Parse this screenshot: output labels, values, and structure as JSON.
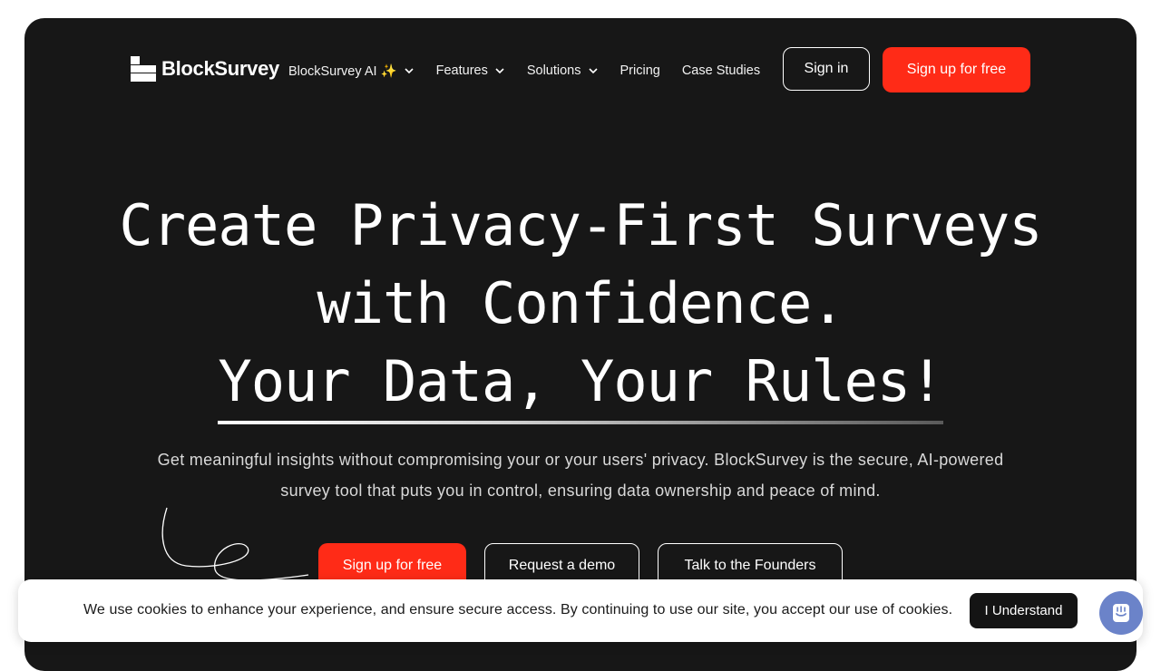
{
  "nav": {
    "logo_text": "BlockSurvey",
    "items": [
      {
        "label": "BlockSurvey AI ✨",
        "dropdown": true
      },
      {
        "label": "Features",
        "dropdown": true
      },
      {
        "label": "Solutions",
        "dropdown": true
      },
      {
        "label": "Pricing",
        "dropdown": false
      },
      {
        "label": "Case Studies",
        "dropdown": false
      }
    ],
    "signin_label": "Sign in",
    "signup_label": "Sign up for free"
  },
  "hero": {
    "headline_line1": "Create Privacy-First Surveys",
    "headline_line2": "with Confidence.",
    "headline_line3": "Your Data, Your Rules!",
    "subtext": "Get meaningful insights without compromising your or your users' privacy. BlockSurvey is the secure, AI-powered survey tool that puts you in control, ensuring data ownership and peace of mind.",
    "cta_primary": "Sign up for free",
    "cta_demo": "Request a demo",
    "cta_founders": "Talk to the Founders"
  },
  "cookie_banner": {
    "text": "We use cookies to enhance your experience, and ensure secure access. By continuing to use our site, you accept our use of cookies.",
    "button_label": "I Understand"
  },
  "icons": {
    "chevron": "chevron-down-icon",
    "chat": "chat-icon"
  },
  "colors": {
    "accent": "#ff2b17",
    "hero_bg": "#171717",
    "chat_bg": "#6b83c9"
  }
}
